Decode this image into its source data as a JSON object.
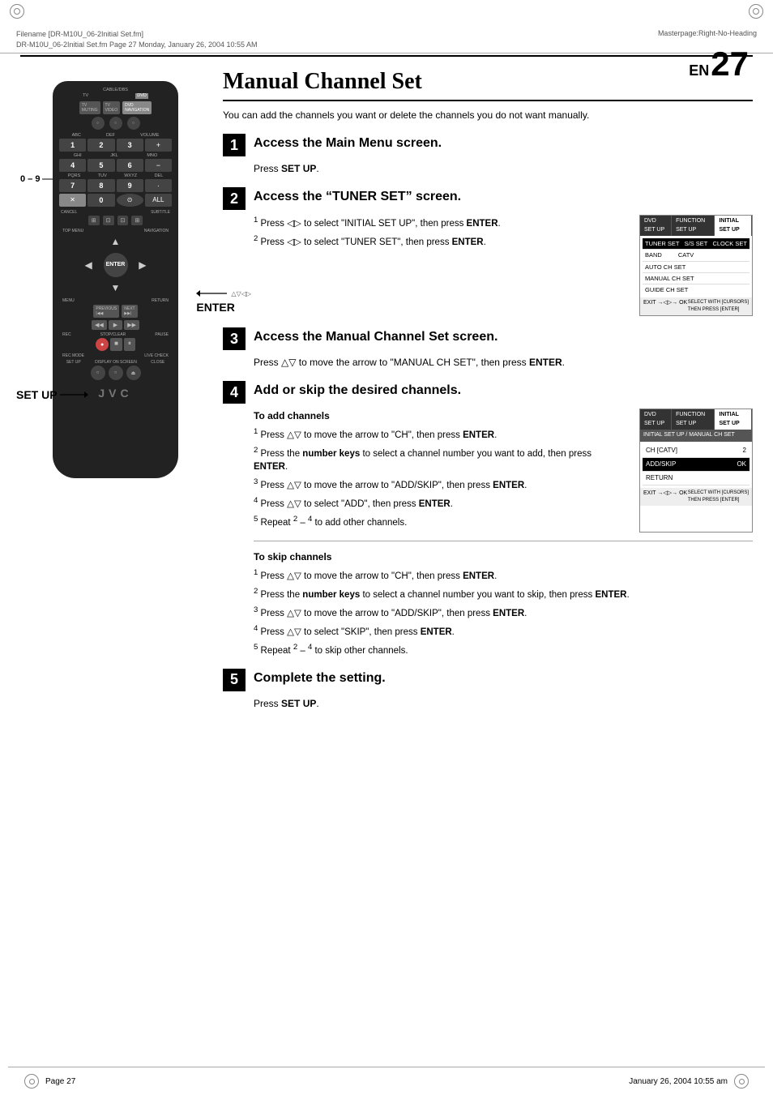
{
  "header": {
    "filename": "Filename [DR-M10U_06-2Initial Set.fm]",
    "file_detail": "DR-M10U_06-2Initial Set.fm  Page 27  Monday, January 26, 2004  10:55 AM",
    "masterpage": "Masterpage:Right-No-Heading"
  },
  "page": {
    "number": "27",
    "en_label": "EN"
  },
  "title": "Manual Channel Set",
  "intro": "You can add the channels you want or delete the channels you do not want manually.",
  "steps": [
    {
      "number": "1",
      "title": "Access the Main Menu screen.",
      "instruction": "Press SET UP."
    },
    {
      "number": "2",
      "title": "Access the “TUNER SET” screen.",
      "sub_steps": [
        "Press ◁▷ to select “INITIAL SET UP”, then press ENTER.",
        "Press ◁▷ to select “TUNER SET”, then press ENTER."
      ],
      "screen": {
        "tabs": [
          "DVD SET UP",
          "FUNCTION SET UP",
          "INITIAL SET UP"
        ],
        "active_tab": "INITIAL SET UP",
        "rows": [
          "TUNER SET",
          "S/S SET",
          "CLOCK SET",
          "BAND",
          "CATV",
          "AUTO CH SET",
          "MANUAL CH SET",
          "GUIDE CH SET"
        ],
        "selected_row": "TUNER SET",
        "footer_left": "EXIT → ◁▷ → OK",
        "footer_right": "SELECT WITH [CURSORS] THEN PRESS [ENTER]"
      }
    },
    {
      "number": "3",
      "title": "Access the Manual Channel Set screen.",
      "instruction": "Press △▽ to move the arrow to “MANUAL CH SET”, then press ENTER."
    },
    {
      "number": "4",
      "title": "Add or skip the desired channels.",
      "to_add_title": "To add channels",
      "to_add_steps": [
        "Press △▽ to move the arrow to “CH”, then press ENTER.",
        "Press the number keys to select a channel number you want to add, then press ENTER.",
        "Press △▽ to move the arrow to “ADD/SKIP”, then press ENTER.",
        "Press △▽ to select “ADD”, then press ENTER.",
        "Repeat 2 – 4 to add other channels."
      ],
      "screen2": {
        "tabs": [
          "DVD SET UP",
          "FUNCTION SET UP",
          "INITIAL SET UP"
        ],
        "active_tab": "INITIAL SET UP",
        "sub_header": "INITIAL SET UP / MANUAL CH SET",
        "rows": [
          {
            "label": "CH [CATV]",
            "value": "2"
          },
          {
            "label": "ADD/SKIP",
            "value": "OK"
          },
          {
            "label": "RETURN",
            "value": ""
          }
        ],
        "footer_left": "EXIT → ◁▷ → OK",
        "footer_right": "SELECT WITH [CURSORS] THEN PRESS [ENTER]"
      },
      "to_skip_title": "To skip channels",
      "to_skip_steps": [
        "Press △▽ to move the arrow to “CH”, then press ENTER.",
        "Press the number keys to select a channel number you want to skip, then press ENTER.",
        "Press △▽ to move the arrow to “ADD/SKIP”, then press ENTER.",
        "Press △▽ to select “SKIP”, then press ENTER.",
        "Repeat 2 – 4 to skip other channels."
      ]
    },
    {
      "number": "5",
      "title": "Complete the setting.",
      "instruction": "Press SET UP."
    }
  ],
  "labels": {
    "zero_nine": "0 – 9",
    "enter_label": "ENTER",
    "enter_arrows": "△▽◁▷",
    "setup_label": "SET UP"
  },
  "footer": {
    "left": "Page 27",
    "right": "January 26, 2004  10:55 am"
  }
}
